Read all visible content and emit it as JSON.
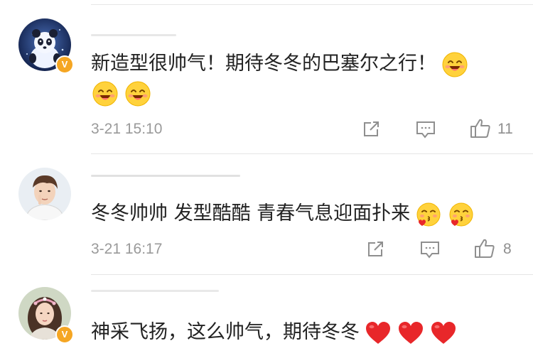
{
  "comments": [
    {
      "text": "新造型很帅气！期待冬冬的巴塞尔之行！",
      "emojis": [
        "smile-blush-icon",
        "smile-blush-icon",
        "smile-blush-icon"
      ],
      "time": "3-21 15:10",
      "like_count": "11",
      "verified_badge": "V"
    },
    {
      "text": "冬冬帅帅 发型酷酷 青春气息迎面扑来",
      "emojis": [
        "kiss-heart-icon",
        "kiss-heart-icon"
      ],
      "time": "3-21 16:17",
      "like_count": "8"
    },
    {
      "text": "神采飞扬，这么帅气，期待冬冬",
      "emojis": [
        "red-heart-icon",
        "red-heart-icon",
        "red-heart-icon"
      ],
      "verified_badge": "V"
    }
  ],
  "colors": {
    "badge": "#f5a623",
    "heart": "#e8272a",
    "emoji_face": "#ffd23c",
    "meta_text": "#9a9a9a"
  }
}
